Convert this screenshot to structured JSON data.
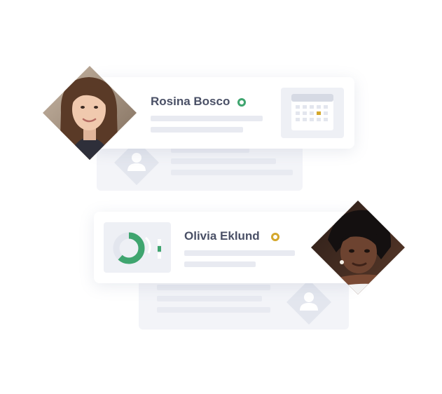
{
  "cards": [
    {
      "name": "Rosina Bosco",
      "status_color": "#3fa56f",
      "widget": "calendar-icon"
    },
    {
      "name": "Olivia Eklund",
      "status_color": "#d4a72c",
      "widget": "donut-chart-icon"
    }
  ],
  "colors": {
    "accent_green": "#3fa56f",
    "accent_yellow": "#d4a72c",
    "placeholder": "#e8eaf1",
    "ghost_card": "#f3f4f8",
    "text": "#4a5066"
  },
  "donut": {
    "filled_fraction": 0.62
  }
}
